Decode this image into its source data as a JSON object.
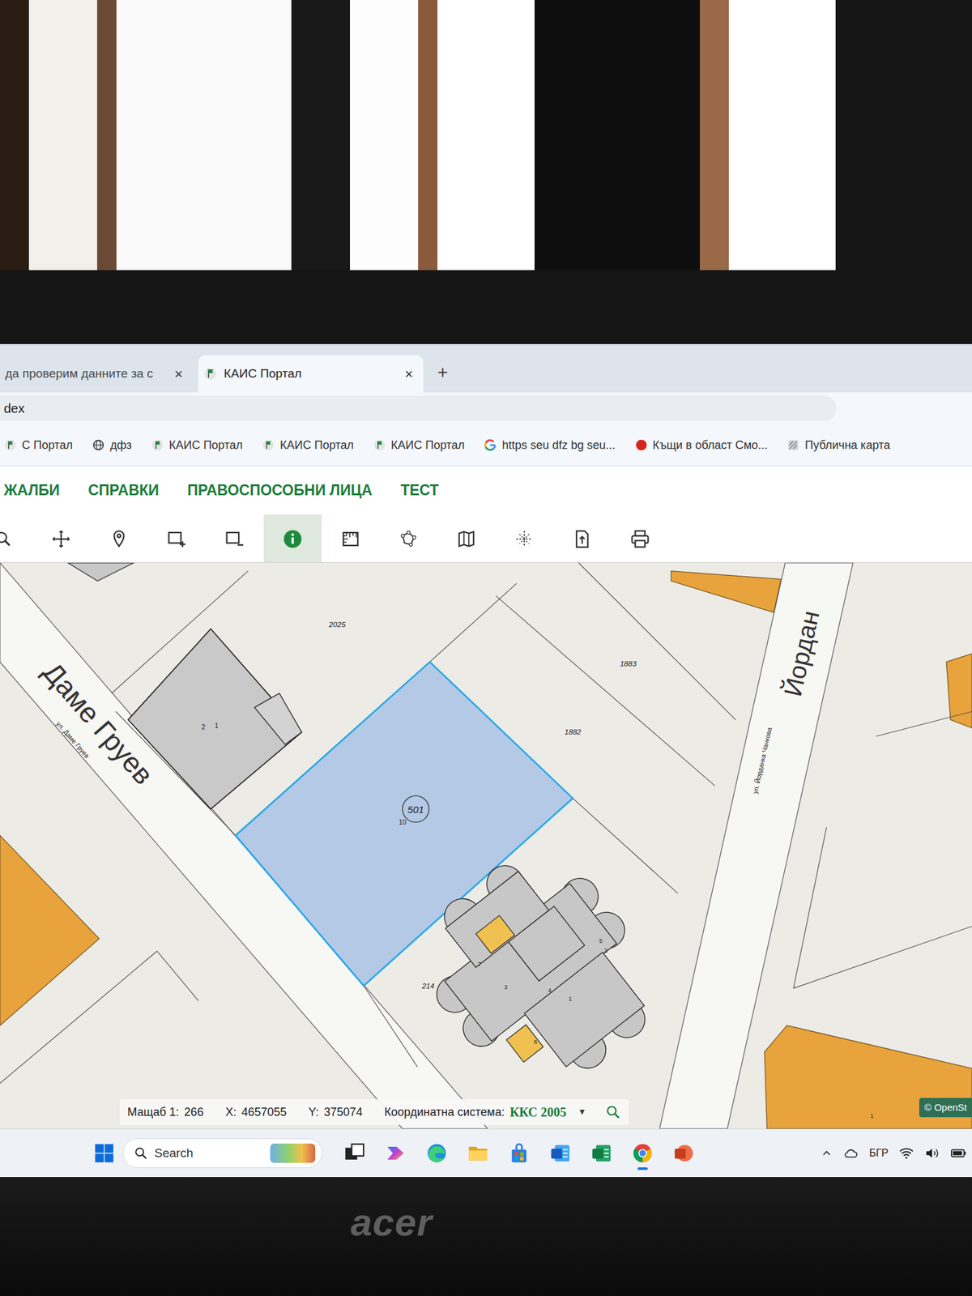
{
  "browser": {
    "tabs": [
      {
        "label": "да проверим данните за с",
        "selected": false,
        "close": "×"
      },
      {
        "label": "КАИС Портал",
        "selected": true,
        "close": "×"
      }
    ],
    "new_tab": "+",
    "address": "dex"
  },
  "bookmarks": [
    {
      "label": "С Портал",
      "kind": "kais"
    },
    {
      "label": "дфз",
      "kind": "globe"
    },
    {
      "label": "КАИС Портал",
      "kind": "kais"
    },
    {
      "label": "КАИС Портал",
      "kind": "kais"
    },
    {
      "label": "КАИС Портал",
      "kind": "kais"
    },
    {
      "label": "https seu dfz bg seu...",
      "kind": "google"
    },
    {
      "label": "Къщи в област Смо...",
      "kind": "red"
    },
    {
      "label": "Публична карта",
      "kind": "map"
    }
  ],
  "menu": [
    "ЖАЛБИ",
    "СПРАВКИ",
    "ПРАВОСПОСОБНИ ЛИЦА",
    "ТЕСТ"
  ],
  "toolbar": [
    {
      "kind": "zoom",
      "selected": false
    },
    {
      "kind": "pan",
      "selected": false
    },
    {
      "kind": "pin",
      "selected": false
    },
    {
      "kind": "rect-plus",
      "selected": false
    },
    {
      "kind": "rect-minus",
      "selected": false
    },
    {
      "kind": "info",
      "selected": true
    },
    {
      "kind": "measure",
      "selected": false
    },
    {
      "kind": "polygon",
      "selected": false
    },
    {
      "kind": "map",
      "selected": false
    },
    {
      "kind": "crosshair",
      "selected": false
    },
    {
      "kind": "export",
      "selected": false
    },
    {
      "kind": "print",
      "selected": false
    }
  ],
  "map": {
    "parcels": [
      {
        "label": "2025"
      },
      {
        "label": "1883"
      },
      {
        "label": "1882"
      },
      {
        "label": "214"
      }
    ],
    "selected_parcel": {
      "number": "501",
      "sub": "10",
      "selected": true
    },
    "streets": [
      {
        "name": "Даме Груев",
        "sign": "ул. Даме Груев"
      },
      {
        "name": "Йордан",
        "sign": "ул. Йорданка Чанкова"
      }
    ],
    "building_labels": [
      "2",
      "1"
    ],
    "complex_labels": [
      "7",
      "3",
      "4",
      "1",
      "5",
      "2",
      "6"
    ],
    "block_label": "1",
    "attribution": "© OpenSt"
  },
  "status_bar": {
    "scale_label": "Мащаб 1:",
    "scale": "266",
    "x_label": "X:",
    "x": "4657055",
    "y_label": "Y:",
    "y": "375074",
    "crs_label": "Координатна система:",
    "crs": "ККС 2005",
    "dropdown": "▼"
  },
  "taskbar": {
    "search": "Search",
    "language": "БГР",
    "apps": [
      {
        "kind": "taskview",
        "selected": false
      },
      {
        "kind": "copilot",
        "selected": false
      },
      {
        "kind": "edge",
        "selected": false
      },
      {
        "kind": "explorer",
        "selected": false
      },
      {
        "kind": "store",
        "selected": false
      },
      {
        "kind": "word",
        "selected": false
      },
      {
        "kind": "excel",
        "selected": false
      },
      {
        "kind": "chrome",
        "selected": true
      },
      {
        "kind": "powerpoint",
        "selected": false
      }
    ]
  },
  "laptop": {
    "brand": "acer"
  }
}
